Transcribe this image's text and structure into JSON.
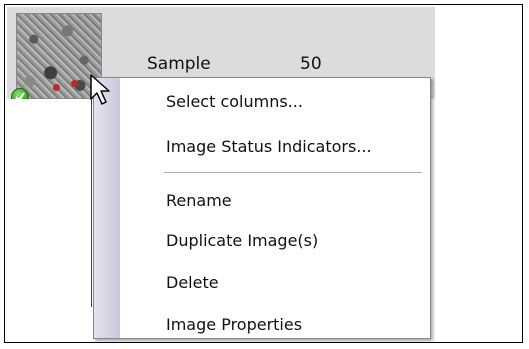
{
  "row": {
    "label": "Sample",
    "value": "50"
  },
  "context_menu": {
    "items": [
      {
        "label": "Select columns..."
      },
      {
        "label": "Image Status Indicators..."
      },
      {
        "label": "Rename"
      },
      {
        "label": "Duplicate Image(s)"
      },
      {
        "label": "Delete"
      },
      {
        "label": "Image Properties"
      }
    ]
  },
  "icons": {
    "status": "checkmark-icon",
    "cursor": "mouse-pointer-icon"
  },
  "colors": {
    "row_highlight": "#dcdcdc",
    "status_green": "#2e9a1c",
    "menu_gutter": "#c9c9dd"
  }
}
